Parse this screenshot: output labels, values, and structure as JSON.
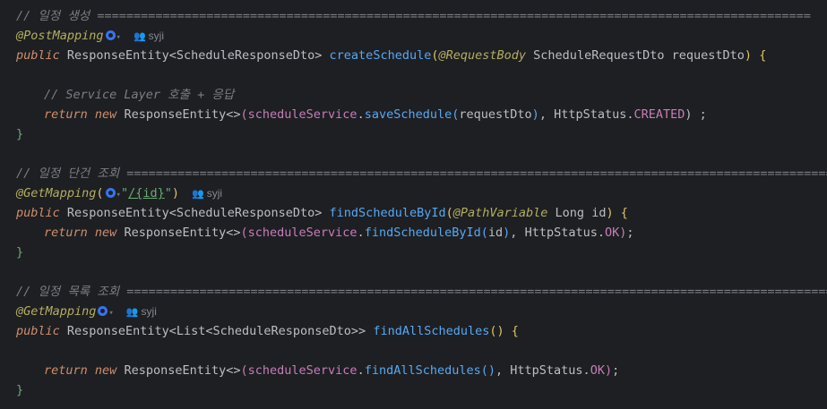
{
  "lines": {
    "c1": "// 일정 생성 ==================================================================================================",
    "a1": "@PostMapping",
    "a1_author": "syji",
    "m1_public": "public",
    "m1_type": "ResponseEntity<ScheduleResponseDto>",
    "m1_name": "createSchedule",
    "m1_ann": "@RequestBody",
    "m1_ptype": "ScheduleRequestDto",
    "m1_pname": "requestDto",
    "c2": "// Service Layer 호출 + 응답",
    "r1_return": "return",
    "r1_new": "new",
    "r1_type": "ResponseEntity<>",
    "r1_field": "scheduleService",
    "r1_call": "saveSchedule",
    "r1_arg": "requestDto",
    "r1_status": "HttpStatus.",
    "r1_const": "CREATED",
    "r1_tail": ") ;",
    "close1": "}",
    "c3": "// 일정 단건 조회 ==================================================================================================",
    "a2": "@GetMapping",
    "a2_path": "/{id}",
    "a2_author": "syji",
    "m2_public": "public",
    "m2_type": "ResponseEntity<ScheduleResponseDto>",
    "m2_name": "findScheduleById",
    "m2_ann": "@PathVariable",
    "m2_ptype": "Long",
    "m2_pname": "id",
    "r2_return": "return",
    "r2_new": "new",
    "r2_type": "ResponseEntity<>",
    "r2_field": "scheduleService",
    "r2_call": "findScheduleById",
    "r2_arg": "id",
    "r2_status": "HttpStatus.",
    "r2_const": "OK",
    "close2": "}",
    "c4": "// 일정 목록 조회 ==================================================================================================",
    "a3": "@GetMapping",
    "a3_author": "syji",
    "m3_public": "public",
    "m3_type": "ResponseEntity<List<ScheduleResponseDto>>",
    "m3_name": "findAllSchedules",
    "r3_return": "return",
    "r3_new": "new",
    "r3_type": "ResponseEntity<>",
    "r3_field": "scheduleService",
    "r3_call": "findAllSchedules",
    "r3_status": "HttpStatus.",
    "r3_const": "OK",
    "close3": "}"
  },
  "icons": {
    "endpoint": "endpoint-globe-icon",
    "author": "person-icon"
  },
  "colors": {
    "background": "#1e1f22",
    "comment": "#7a7e85",
    "annotation": "#b3ae60",
    "keyword": "#cf8e6d",
    "function": "#56a8f5",
    "field": "#c77dba",
    "string": "#6aab73"
  }
}
